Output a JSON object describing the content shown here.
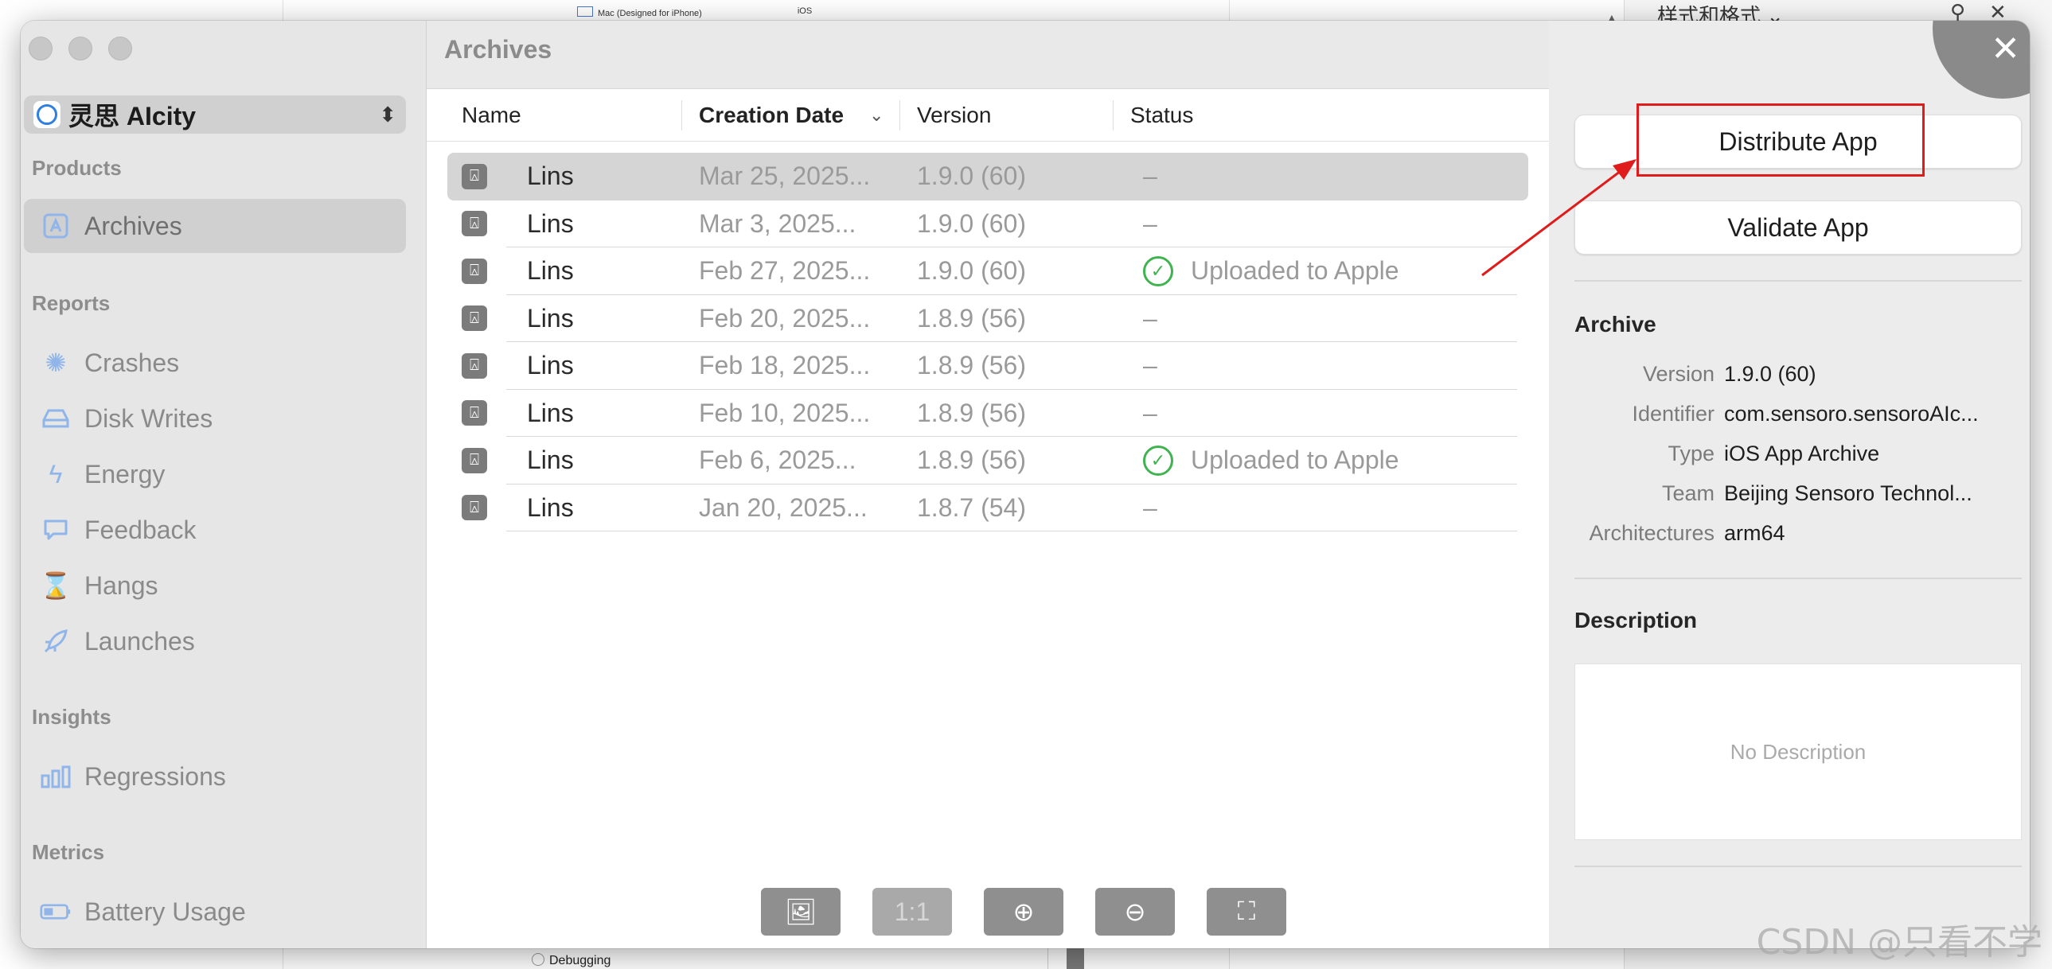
{
  "background": {
    "top_items": [
      "Mac (Designed for iPhone)",
      "iOS"
    ],
    "right_title": "样式和格式 ⌄",
    "right_icons": [
      "pin-icon",
      "close-icon"
    ],
    "bottom_item": "Debugging"
  },
  "sidebar": {
    "app_name": "灵思 AIcity",
    "sections": {
      "products": "Products",
      "reports": "Reports",
      "insights": "Insights",
      "metrics": "Metrics"
    },
    "products": [
      {
        "label": "Archives",
        "icon": "archive-icon",
        "selected": true
      }
    ],
    "reports": [
      {
        "label": "Crashes",
        "icon": "crash-icon"
      },
      {
        "label": "Disk Writes",
        "icon": "disk-icon"
      },
      {
        "label": "Energy",
        "icon": "energy-icon"
      },
      {
        "label": "Feedback",
        "icon": "feedback-icon"
      },
      {
        "label": "Hangs",
        "icon": "hourglass-icon"
      },
      {
        "label": "Launches",
        "icon": "rocket-icon"
      }
    ],
    "insights": [
      {
        "label": "Regressions",
        "icon": "chart-icon"
      }
    ],
    "metrics": [
      {
        "label": "Battery Usage",
        "icon": "battery-icon"
      }
    ]
  },
  "archives": {
    "title": "Archives",
    "columns": {
      "name": "Name",
      "date": "Creation Date",
      "version": "Version",
      "status": "Status"
    },
    "rows": [
      {
        "name": "Lins",
        "date": "Mar 25, 2025...",
        "version": "1.9.0 (60)",
        "status": "–",
        "uploaded": false
      },
      {
        "name": "Lins",
        "date": "Mar 3, 2025...",
        "version": "1.9.0 (60)",
        "status": "–",
        "uploaded": false
      },
      {
        "name": "Lins",
        "date": "Feb 27, 2025...",
        "version": "1.9.0 (60)",
        "status": "Uploaded to Apple",
        "uploaded": true
      },
      {
        "name": "Lins",
        "date": "Feb 20, 2025...",
        "version": "1.8.9 (56)",
        "status": "–",
        "uploaded": false
      },
      {
        "name": "Lins",
        "date": "Feb 18, 2025...",
        "version": "1.8.9 (56)",
        "status": "–",
        "uploaded": false
      },
      {
        "name": "Lins",
        "date": "Feb 10, 2025...",
        "version": "1.8.9 (56)",
        "status": "–",
        "uploaded": false
      },
      {
        "name": "Lins",
        "date": "Feb 6, 2025...",
        "version": "1.8.9 (56)",
        "status": "Uploaded to Apple",
        "uploaded": true
      },
      {
        "name": "Lins",
        "date": "Jan 20, 2025...",
        "version": "1.8.7 (54)",
        "status": "–",
        "uploaded": false
      }
    ],
    "toolbar": [
      {
        "name": "image-edit-icon",
        "label": "🖼"
      },
      {
        "name": "actual-size-button",
        "label": "1:1"
      },
      {
        "name": "zoom-in-icon",
        "label": "⊕"
      },
      {
        "name": "zoom-out-icon",
        "label": "⊖"
      },
      {
        "name": "fit-screen-icon",
        "label": "⛶"
      }
    ]
  },
  "inspector": {
    "distribute_label": "Distribute App",
    "validate_label": "Validate App",
    "archive_heading": "Archive",
    "archive": [
      {
        "key": "Version",
        "value": "1.9.0 (60)"
      },
      {
        "key": "Identifier",
        "value": "com.sensoro.sensoroAIc..."
      },
      {
        "key": "Type",
        "value": "iOS App Archive"
      },
      {
        "key": "Team",
        "value": "Beijing Sensoro Technol..."
      },
      {
        "key": "Architectures",
        "value": "arm64"
      }
    ],
    "description_heading": "Description",
    "description_placeholder": "No Description"
  },
  "watermark": "CSDN @只看不学",
  "colors": {
    "annotation_red": "#e01b1b",
    "uploaded_green": "#3fb34f",
    "sidebar_icon_blue": "#8fb5ea"
  }
}
